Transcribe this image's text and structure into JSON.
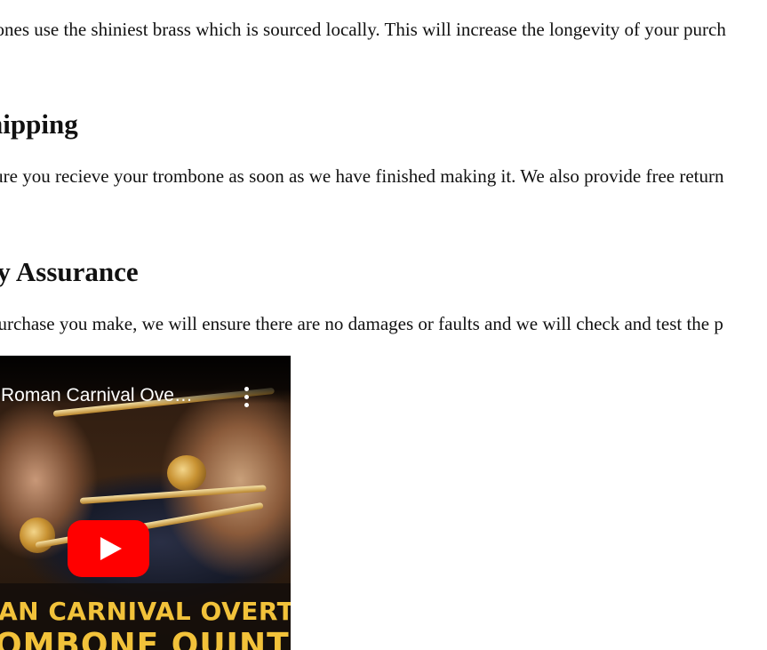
{
  "content": {
    "quality_paragraph": "bones use the shiniest brass which is sourced locally. This will increase the longevity of your purch",
    "shipping_heading": "hipping",
    "shipping_paragraph": "sure you recieve your trombone as soon as we have finished making it. We also provide free return",
    "assurance_heading": "ty Assurance",
    "assurance_paragraph": "purchase you make, we will ensure there are no damages or faults and we will check and test the p"
  },
  "video": {
    "title": "Roman Carnival Ove…",
    "menu_icon": "more-vertical-icon",
    "play_icon": "play-icon",
    "banner_line1": "AN CARNIVAL OVERT",
    "banner_line2": "OMBONE QUINT",
    "colors": {
      "play_button": "#ff0000",
      "banner_text": "#f2c23a"
    }
  }
}
